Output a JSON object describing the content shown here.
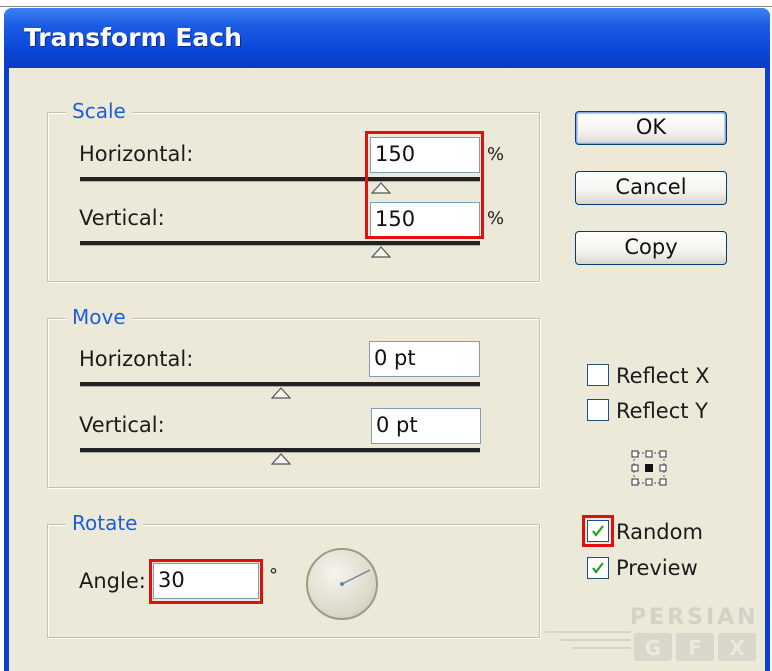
{
  "dialog": {
    "title": "Transform Each"
  },
  "scale": {
    "legend": "Scale",
    "horizontal": {
      "label": "Horizontal:",
      "value": "150",
      "unit": "%"
    },
    "vertical": {
      "label": "Vertical:",
      "value": "150",
      "unit": "%"
    }
  },
  "move": {
    "legend": "Move",
    "horizontal": {
      "label": "Horizontal:",
      "value": "0 pt"
    },
    "vertical": {
      "label": "Vertical:",
      "value": "0 pt"
    }
  },
  "rotate": {
    "legend": "Rotate",
    "angle_label": "Angle:",
    "angle_value": "30",
    "unit": "°"
  },
  "buttons": {
    "ok": "OK",
    "cancel": "Cancel",
    "copy": "Copy"
  },
  "options": {
    "reflect_x": {
      "label": "Reflect X",
      "checked": false
    },
    "reflect_y": {
      "label": "Reflect Y",
      "checked": false
    },
    "random": {
      "label": "Random",
      "checked": true
    },
    "preview": {
      "label": "Preview",
      "checked": true
    }
  },
  "watermark": {
    "text": "PERSIAN",
    "sub": "GFX"
  },
  "colors": {
    "title_bar": "#0c47d8",
    "highlight": "#e01010",
    "legend": "#1e5ed8",
    "face": "#ece9d8"
  }
}
